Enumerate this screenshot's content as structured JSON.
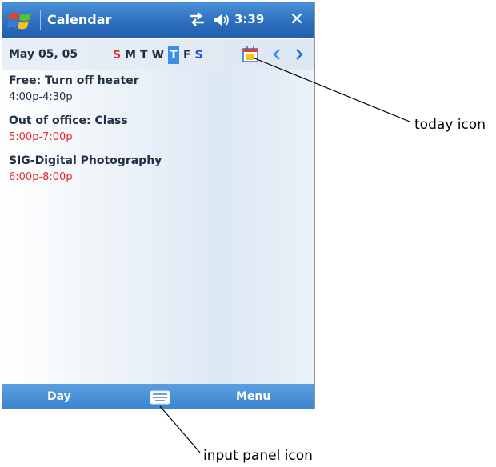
{
  "titlebar": {
    "title": "Calendar",
    "time": "3:39",
    "close_label": "✕"
  },
  "date_row": {
    "date": "May 05, 05",
    "weekdays": [
      "S",
      "M",
      "T",
      "W",
      "T",
      "F",
      "S"
    ]
  },
  "appointments": [
    {
      "title": "Free: Turn off heater",
      "time": "4:00p-4:30p"
    },
    {
      "title": "Out of office: Class",
      "time": "5:00p-7:00p"
    },
    {
      "title": "SIG-Digital Photography",
      "time": "6:00p-8:00p"
    }
  ],
  "bottombar": {
    "left_label": "Day",
    "right_label": "Menu"
  },
  "callouts": {
    "today": "today icon",
    "input": "input panel icon"
  },
  "colors": {
    "titlebar": "#2d6fbf",
    "weekend_red": "#e52a2a",
    "today_highlight": "#3d8ee6"
  }
}
